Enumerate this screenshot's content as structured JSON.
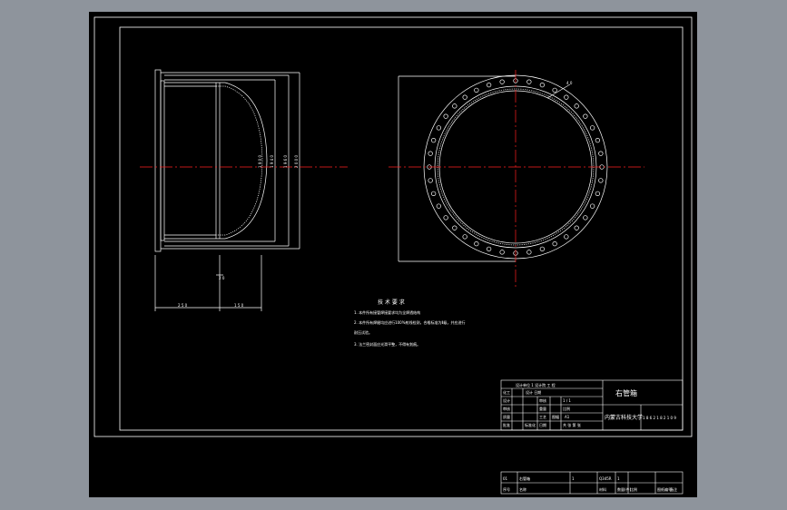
{
  "drawing": {
    "title": "右管箱",
    "school": "内蒙古科技大学",
    "drawing_no": "1 8 6 2 1 8 2 1 0 9",
    "tech_req": {
      "heading": "技 术 要 求",
      "line1": "1. 本件所有接管焊接要求均为全焊透结构",
      "line2": "2. 本件所有焊缝均应进行100%射线检测，合格标准为Ⅱ级，并应进行",
      "line3": "   耐压试验。",
      "line4": "3. 法兰密封面应光滑平整，不得有划痕。"
    },
    "dims": {
      "d1": "1 9 0 0",
      "d2": "1 9 4 0",
      "d3": "1 9 6 0",
      "d4": "2 0 0 0",
      "bottom_left": "2 5 0",
      "bottom_right": "1 5 0",
      "thickness": "2 0",
      "bolt_holes": "4 0"
    },
    "title_block": {
      "r1": "设计单位 1 设计院 工  程",
      "r2": "设计 日期",
      "r3a": "审核",
      "r3b": "1 / 1",
      "r4a": "重量",
      "r4b": "比例",
      "r5a": "工艺",
      "r5b": "图幅",
      "r5c": "A1",
      "r6a": "标准化",
      "r6b": "日期",
      "r6c": "共 张 第 张",
      "label_huagong": "化工",
      "label_sheji": "设计",
      "label_shenhe": "审核",
      "label_zhiliang": "质量",
      "label_pizhun": "批准"
    },
    "parts_table": {
      "row1": [
        "01",
        "右管箱",
        "1",
        "Q345R",
        "1",
        "",
        "",
        ""
      ],
      "row2": [
        "序号",
        "名称",
        "",
        "材料",
        "数量(件)",
        "比例",
        "图纸编号",
        "备注"
      ]
    }
  }
}
